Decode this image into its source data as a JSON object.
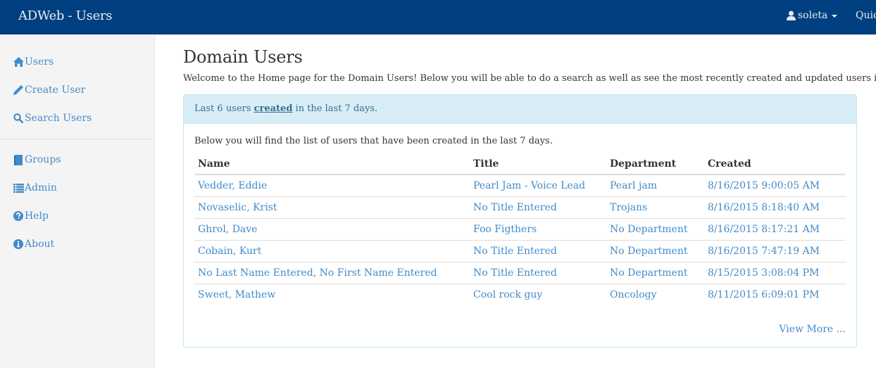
{
  "navbar": {
    "brand": "ADWeb - Users",
    "user_name": "soleta",
    "user_icon": "user-icon",
    "quick_link": "Quick"
  },
  "sidebar": {
    "groups": [
      [
        {
          "label": "Users",
          "icon": "home-icon"
        },
        {
          "label": "Create User",
          "icon": "pencil-icon"
        },
        {
          "label": "Search Users",
          "icon": "search-icon"
        }
      ],
      [
        {
          "label": "Groups",
          "icon": "book-icon"
        },
        {
          "label": "Admin",
          "icon": "list-icon"
        },
        {
          "label": "Help",
          "icon": "question-circle-icon"
        },
        {
          "label": "About",
          "icon": "info-circle-icon"
        }
      ]
    ]
  },
  "main": {
    "title": "Domain Users",
    "welcome": "Welcome to the Home page for the Domain Users! Below you will be able to do a search as well as see the most recently created and updated users in the domain",
    "panel": {
      "heading_prefix": "Last 6 users ",
      "heading_link": "created",
      "heading_suffix": " in the last 7 days.",
      "description": "Below you will find the list of users that have been created in the last 7 days.",
      "columns": [
        "Name",
        "Title",
        "Department",
        "Created"
      ],
      "rows": [
        [
          "Vedder, Eddie",
          "Pearl Jam - Voice Lead",
          "Pearl jam",
          "8/16/2015 9:00:05 AM"
        ],
        [
          "Novaselic, Krist",
          "No Title Entered",
          "Trojans",
          "8/16/2015 8:18:40 AM"
        ],
        [
          "Ghrol, Dave",
          "Foo Figthers",
          "No Department",
          "8/16/2015 8:17:21 AM"
        ],
        [
          "Cobain, Kurt",
          "No Title Entered",
          "No Department",
          "8/16/2015 7:47:19 AM"
        ],
        [
          "No Last Name Entered, No First Name Entered",
          "No Title Entered",
          "No Department",
          "8/15/2015 3:08:04 PM"
        ],
        [
          "Sweet, Mathew",
          "Cool rock guy",
          "Oncology",
          "8/11/2015 6:09:01 PM"
        ]
      ],
      "view_more": "View More ..."
    }
  },
  "colors": {
    "navbar_bg": "#004080",
    "link": "#428bca",
    "panel_heading_bg": "#d9edf7",
    "panel_border": "#bce8f1",
    "sidebar_bg": "#f4f4f4"
  }
}
